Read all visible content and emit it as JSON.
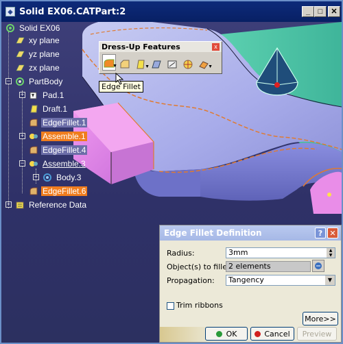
{
  "window": {
    "title": "Solid EX06.CATPart:2"
  },
  "tree": {
    "items": [
      {
        "label": "Solid EX06",
        "state": "normal"
      },
      {
        "label": "xy plane",
        "state": "normal"
      },
      {
        "label": "yz plane",
        "state": "normal"
      },
      {
        "label": "zx plane",
        "state": "normal"
      },
      {
        "label": "PartBody",
        "state": "normal"
      },
      {
        "label": "Pad.1",
        "state": "normal"
      },
      {
        "label": "Draft.1",
        "state": "normal"
      },
      {
        "label": "EdgeFillet.1",
        "state": "dim"
      },
      {
        "label": "Assemble.1",
        "state": "selected"
      },
      {
        "label": "EdgeFillet.4",
        "state": "dim"
      },
      {
        "label": "Assemble.3",
        "state": "underlined"
      },
      {
        "label": "Body.3",
        "state": "normal"
      },
      {
        "label": "EdgeFillet.6",
        "state": "selected"
      },
      {
        "label": "Reference Data",
        "state": "normal"
      }
    ]
  },
  "toolbar": {
    "title": "Dress-Up Features",
    "tooltip": "Edge Fillet",
    "icons": [
      "edge-fillet-icon",
      "chamfer-icon",
      "draft-icon",
      "shell-icon",
      "thickness-icon",
      "thread-icon",
      "remove-face-icon"
    ]
  },
  "dialog": {
    "title": "Edge Fillet Definition",
    "radius_label": "Radius:",
    "radius_value": "3mm",
    "objects_label": "Object(s) to fillet:",
    "objects_value": "2 elements",
    "propagation_label": "Propagation:",
    "propagation_value": "Tangency",
    "trim_label": "Trim ribbons",
    "more_label": "More>>",
    "ok_label": "OK",
    "cancel_label": "Cancel",
    "preview_label": "Preview"
  },
  "colors": {
    "selection": "#f07d1e",
    "background": "#2f3168",
    "titlebar": "#0d2a7a"
  }
}
